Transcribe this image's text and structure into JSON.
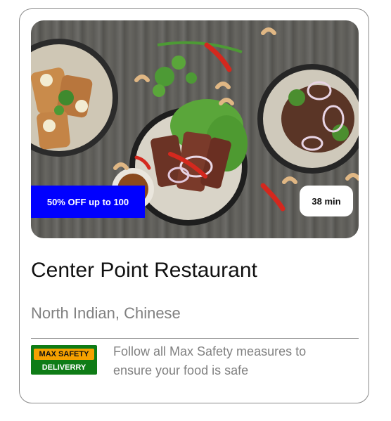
{
  "card": {
    "offer_badge": "50% OFF up to 100",
    "delivery_time": "38 min",
    "restaurant_name": "Center Point Restaurant",
    "cuisines": "North Indian, Chinese",
    "safety_badge": {
      "top_label": "MAX SAFETY",
      "bottom_label": "DELIVERRY",
      "top_color": "#f5a100",
      "bottom_color": "#0e7c16"
    },
    "safety_message": "Follow all Max Safety measures to ensure your food is safe"
  },
  "colors": {
    "offer_background": "#0000ff",
    "title": "#111111",
    "secondary_text": "#808080"
  }
}
